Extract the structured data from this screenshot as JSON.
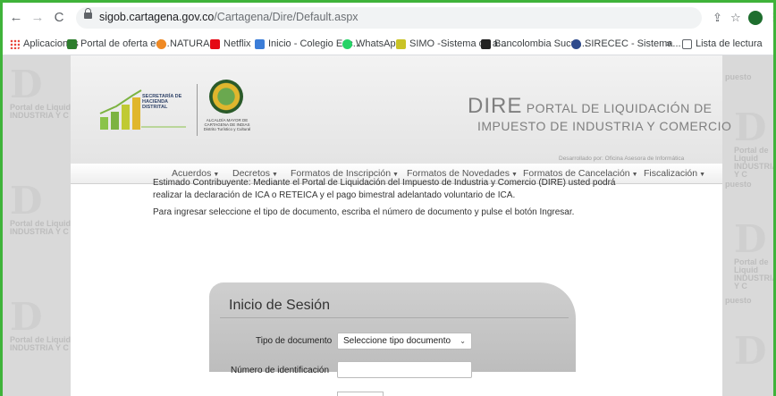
{
  "browser": {
    "url_domain": "sigob.cartagena.gov.co",
    "url_path": "/Cartagena/Dire/Default.aspx"
  },
  "bookmarks": [
    {
      "label": "Aplicaciones",
      "color": "#e8453c"
    },
    {
      "label": "Portal de oferta ed...",
      "color": "#2d7d2d"
    },
    {
      "label": "NATURA",
      "color": "#f08a24"
    },
    {
      "label": "Netflix",
      "color": "#e50914"
    },
    {
      "label": "Inicio - Colegio Euc...",
      "color": "#3b7dd8"
    },
    {
      "label": "WhatsApp",
      "color": "#25d366"
    },
    {
      "label": "SIMO -Sistema de a...",
      "color": "#c9c326"
    },
    {
      "label": "Bancolombia Sucur...",
      "color": "#222222"
    },
    {
      "label": "SIRECEC - Sistema...",
      "color": "#2e4a8c"
    }
  ],
  "bookmarks_more": "»",
  "reading_list": "Lista de lectura",
  "watermark": {
    "line1": "Portal de Liquid",
    "line2": "INDUSTRIA Y C",
    "side": "puesto"
  },
  "header": {
    "secretaria": "SECRETARÍA DE HACIENDA DISTRITAL",
    "seal_text": "ALCALDÍA MAYOR DE CARTAGENA DE INDIAS",
    "seal_sub": "Distrito Turístico y Cultural",
    "title_big": "DIRE",
    "title_rest": " PORTAL DE LIQUIDACIÓN DE",
    "title_sub": "IMPUESTO DE INDUSTRIA Y COMERCIO",
    "developed_by": "Desarrollado por: Oficina Asesora de Informática"
  },
  "nav": [
    "Acuerdos",
    "Decretos",
    "Formatos de Inscripción",
    "Formatos de Novedades",
    "Formatos de Cancelación",
    "Fiscalización"
  ],
  "intro_text": "Estimado Contribuyente: Mediante el Portal de Liquidación del Impuesto de Industria y Comercio (DIRE) usted podrá realizar la declaración de ICA o RETEICA y el pago bimestral adelantado voluntario de ICA.",
  "instructions": "Para ingresar seleccione el tipo de documento, escriba el número de documento y pulse el botón Ingresar.",
  "login": {
    "title": "Inicio de Sesión",
    "doc_type_label": "Tipo de documento",
    "doc_type_value": "Seleccione tipo documento",
    "id_label": "Número de identificación",
    "id_value": ""
  },
  "colors": {
    "accent": "#3fb33a",
    "page_bg": "#d9d9d9"
  }
}
